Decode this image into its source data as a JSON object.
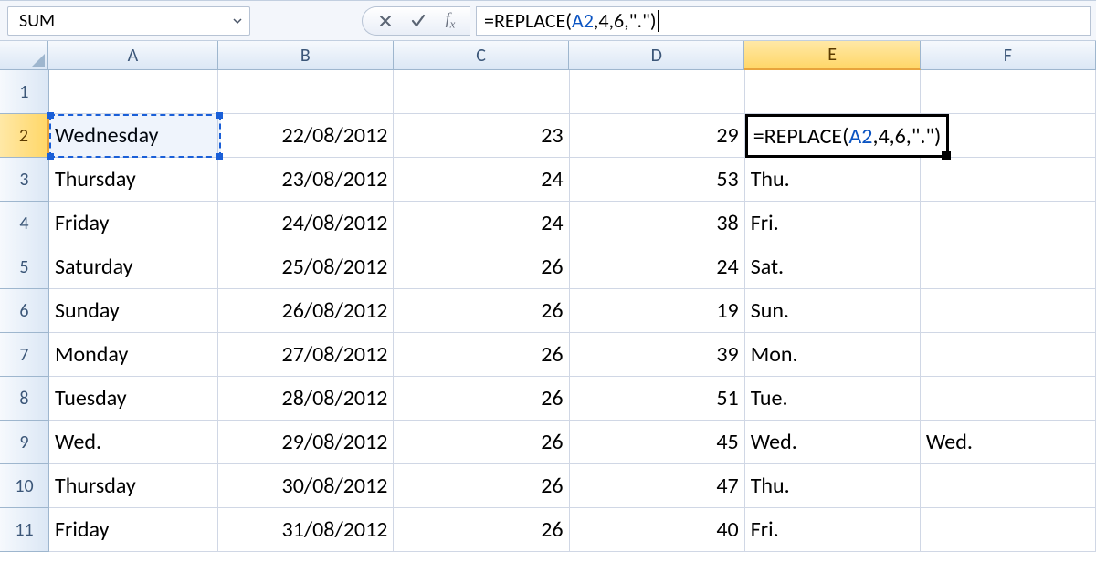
{
  "name_box": {
    "value": "SUM"
  },
  "formula_bar": {
    "prefix": "=REPLACE(",
    "ref": "A2",
    "suffix": ",4,6,\".\")"
  },
  "columns": [
    {
      "label": "A",
      "cls": "cA",
      "active": false
    },
    {
      "label": "B",
      "cls": "cB",
      "active": false
    },
    {
      "label": "C",
      "cls": "cC",
      "active": false
    },
    {
      "label": "D",
      "cls": "cD",
      "active": false
    },
    {
      "label": "E",
      "cls": "cE",
      "active": true
    },
    {
      "label": "F",
      "cls": "cF",
      "active": false
    }
  ],
  "row_labels": [
    "1",
    "2",
    "3",
    "4",
    "5",
    "6",
    "7",
    "8",
    "9",
    "10",
    "11"
  ],
  "active_row_index": 1,
  "rows": [
    {
      "A": "",
      "B": "",
      "C": "",
      "D": "",
      "E": "",
      "F": ""
    },
    {
      "A": "Wednesday",
      "B": "22/08/2012",
      "C": "23",
      "D": "29",
      "E": "",
      "F": ""
    },
    {
      "A": "Thursday",
      "B": "23/08/2012",
      "C": "24",
      "D": "53",
      "E": "Thu.",
      "F": ""
    },
    {
      "A": "Friday",
      "B": "24/08/2012",
      "C": "24",
      "D": "38",
      "E": "Fri.",
      "F": ""
    },
    {
      "A": "Saturday",
      "B": "25/08/2012",
      "C": "26",
      "D": "24",
      "E": "Sat.",
      "F": ""
    },
    {
      "A": "Sunday",
      "B": "26/08/2012",
      "C": "26",
      "D": "19",
      "E": "Sun.",
      "F": ""
    },
    {
      "A": "Monday",
      "B": "27/08/2012",
      "C": "26",
      "D": "39",
      "E": "Mon.",
      "F": ""
    },
    {
      "A": "Tuesday",
      "B": "28/08/2012",
      "C": "26",
      "D": "51",
      "E": "Tue.",
      "F": ""
    },
    {
      "A": "Wed.",
      "B": "29/08/2012",
      "C": "26",
      "D": "45",
      "E": "Wed.",
      "F": "Wed."
    },
    {
      "A": "Thursday",
      "B": "30/08/2012",
      "C": "26",
      "D": "47",
      "E": "Thu.",
      "F": ""
    },
    {
      "A": "Friday",
      "B": "31/08/2012",
      "C": "26",
      "D": "40",
      "E": "Fri.",
      "F": ""
    }
  ],
  "edit_cell": {
    "row_index": 1,
    "col": "E",
    "prefix": "=REPLACE(",
    "ref": "A2",
    "suffix": ",4,6,\".\")"
  },
  "range_ref": {
    "row_index": 1,
    "col": "A"
  },
  "alignment": {
    "A": "left",
    "B": "right",
    "C": "right",
    "D": "right",
    "E": "left",
    "F": "left"
  }
}
